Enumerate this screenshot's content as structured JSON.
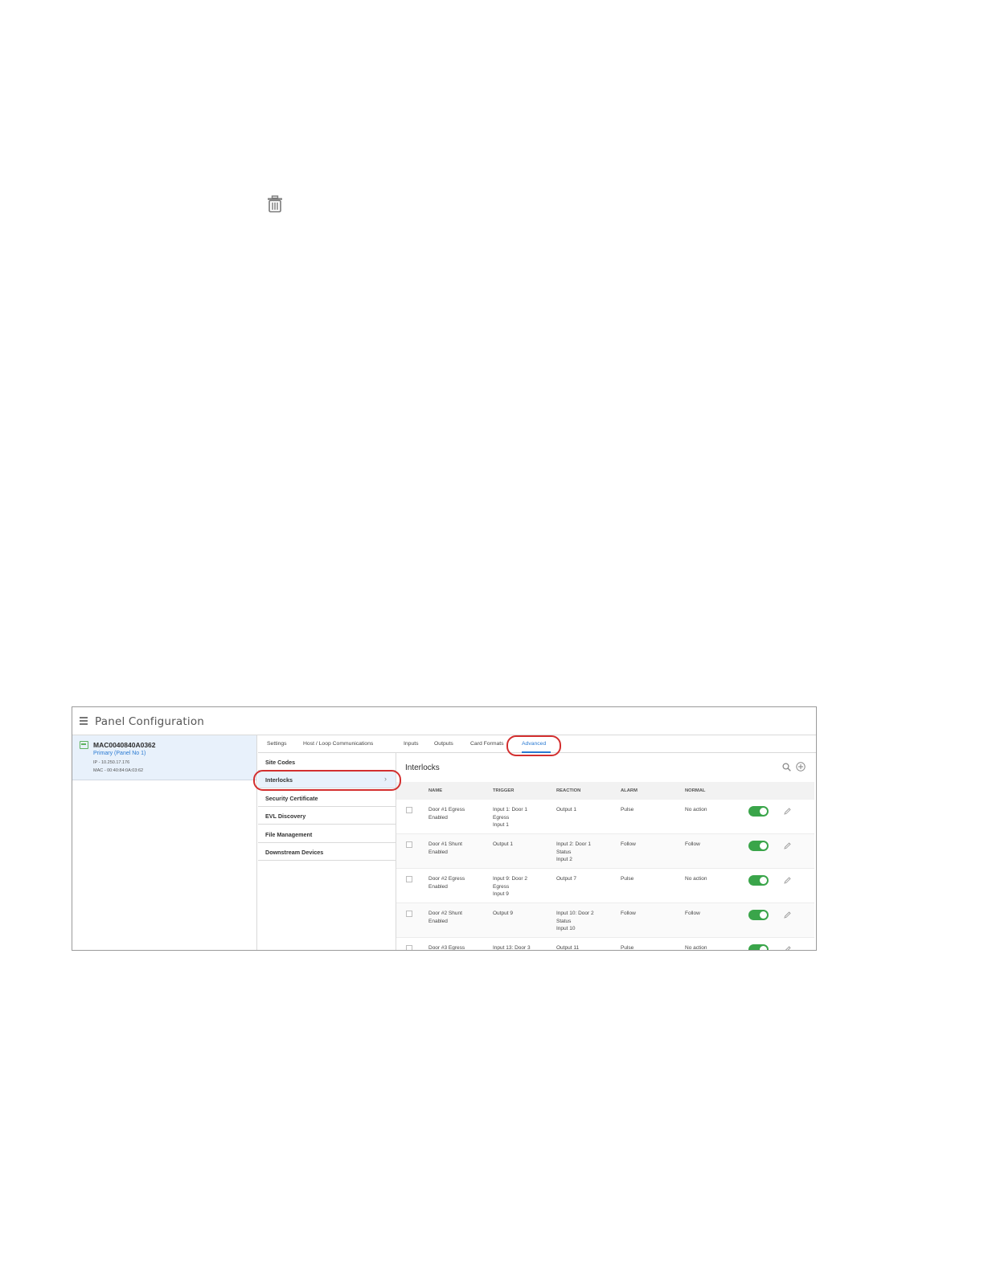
{
  "app": {
    "title": "Panel Configuration"
  },
  "panel": {
    "name": "MAC0040840A0362",
    "role": "Primary (Panel No 1)",
    "ip": "IP - 10.250.17.176",
    "mac": "MAC - 00:40:84:0A:03:62"
  },
  "tabs": [
    {
      "label": "Settings"
    },
    {
      "label": "Host / Loop Communications"
    },
    {
      "label": "Inputs"
    },
    {
      "label": "Outputs"
    },
    {
      "label": "Card Formats"
    },
    {
      "label": "Advanced"
    }
  ],
  "active_tab": "Advanced",
  "subnav": [
    {
      "label": "Site Codes"
    },
    {
      "label": "Interlocks"
    },
    {
      "label": "Security Certificate"
    },
    {
      "label": "EVL Discovery"
    },
    {
      "label": "File Management"
    },
    {
      "label": "Downstream Devices"
    }
  ],
  "active_subnav": "Interlocks",
  "content": {
    "title": "Interlocks"
  },
  "table": {
    "headers": [
      "NAME",
      "TRIGGER",
      "REACTION",
      "ALARM",
      "NORMAL"
    ],
    "rows": [
      {
        "name": "Door #1 Egress\nEnabled",
        "trigger": "Input 1: Door 1\nEgress\nInput 1",
        "reaction": "Output 1",
        "alarm": "Pulse",
        "normal": "No action",
        "enabled": true
      },
      {
        "name": "Door #1 Shunt\nEnabled",
        "trigger": "Output 1",
        "reaction": "Input 2: Door 1\nStatus\nInput 2",
        "alarm": "Follow",
        "normal": "Follow",
        "enabled": true
      },
      {
        "name": "Door #2 Egress\nEnabled",
        "trigger": "Input 9: Door 2\nEgress\nInput 9",
        "reaction": "Output 7",
        "alarm": "Pulse",
        "normal": "No action",
        "enabled": true
      },
      {
        "name": "Door #2 Shunt\nEnabled",
        "trigger": "Output 9",
        "reaction": "Input 10: Door 2\nStatus\nInput 10",
        "alarm": "Follow",
        "normal": "Follow",
        "enabled": true
      },
      {
        "name": "Door #3 Egress",
        "trigger": "Input 13: Door 3",
        "reaction": "Output 11",
        "alarm": "Pulse",
        "normal": "No action",
        "enabled": true
      }
    ]
  },
  "colors": {
    "accent": "#2a7ad2",
    "toggle_on": "#3aa54a",
    "annotation": "#d32f2f",
    "selected_bg": "#e8f1fb"
  },
  "icons": [
    "trash-icon",
    "hamburger-icon",
    "panel-icon",
    "chevron-right-icon",
    "search-icon",
    "add-circle-icon",
    "edit-pencil-icon"
  ]
}
